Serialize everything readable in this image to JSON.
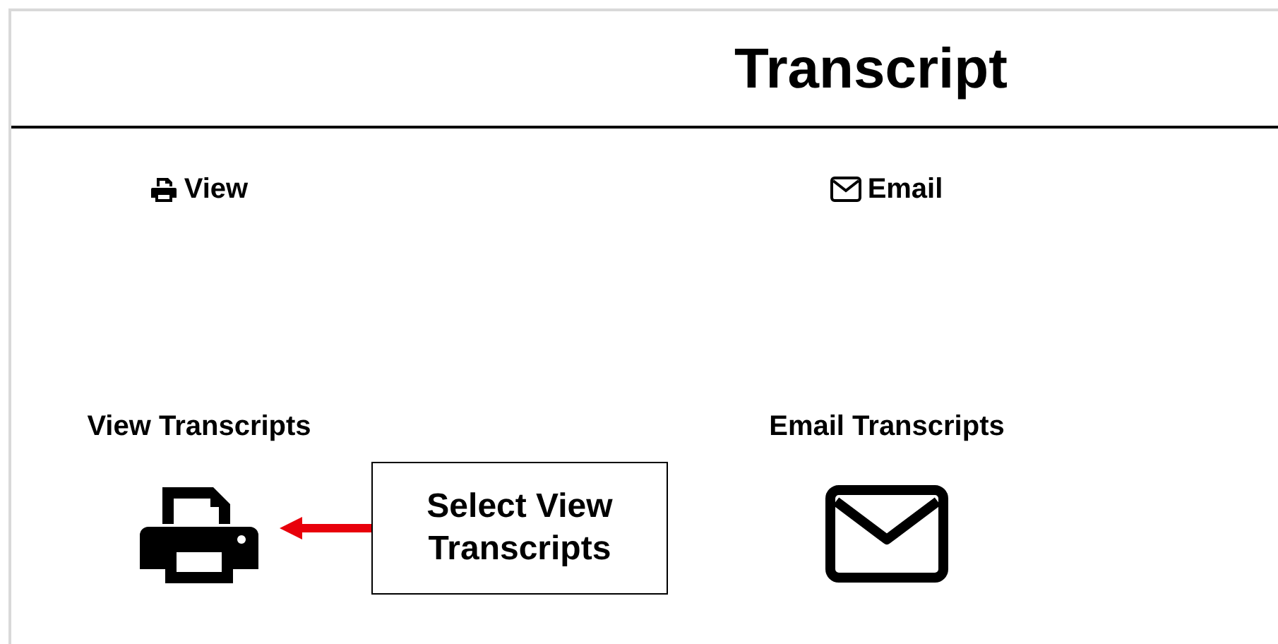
{
  "page": {
    "title": "Transcript"
  },
  "tabs": [
    {
      "label": "View",
      "kind": "print"
    },
    {
      "label": "Email",
      "kind": "email"
    }
  ],
  "cards": [
    {
      "title": "View Transcripts",
      "kind": "print"
    },
    {
      "title": "Email Transcripts",
      "kind": "email"
    }
  ],
  "callout": {
    "text": "Select View Transcripts"
  }
}
